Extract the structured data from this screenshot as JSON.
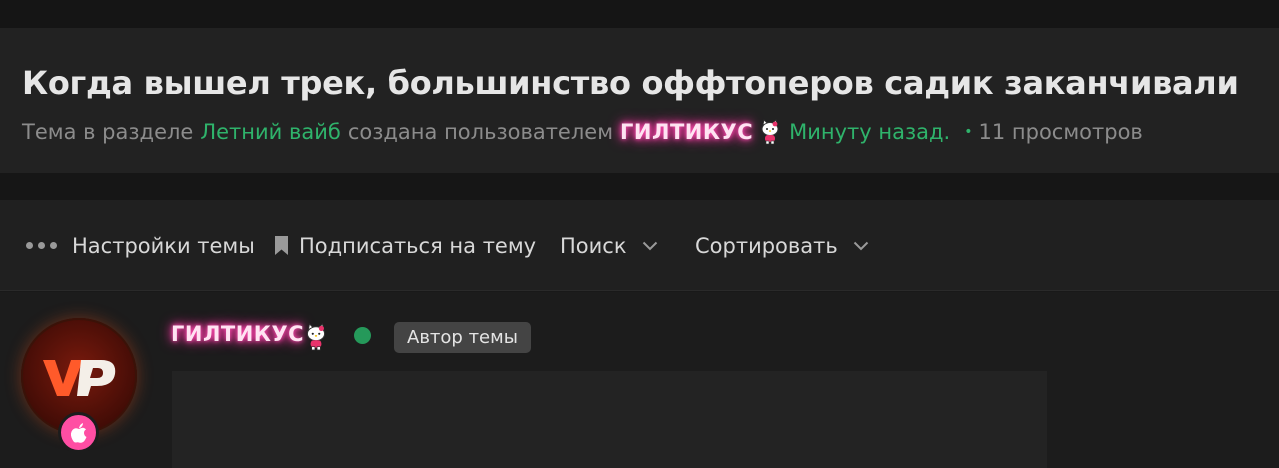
{
  "thread": {
    "title": "Когда вышел трек, большинство оффтоперов садик заканчивали",
    "meta_prefix": "Тема в разделе",
    "section": "Летний вайб",
    "meta_created_by": "создана пользователем",
    "author": "ГИЛТИКУС",
    "time": "Минуту назад.",
    "separator": "•",
    "views": "11 просмотров"
  },
  "toolbar": {
    "settings_label": "Настройки темы",
    "subscribe_label": "Подписаться на тему",
    "search_label": "Поиск",
    "sort_label": "Сортировать"
  },
  "post": {
    "username": "ГИЛТИКУС",
    "author_tag": "Автор темы",
    "online": true
  },
  "icons": {
    "more": "more-dots-icon",
    "bookmark": "bookmark-icon",
    "chevron": "chevron-down-icon",
    "emoji": "hello-kitty-icon",
    "apple": "apple-icon"
  },
  "colors": {
    "link": "#2fb36b",
    "glow": "#ff3da7",
    "online": "#25995a",
    "apple_badge": "#ff4ea3"
  }
}
